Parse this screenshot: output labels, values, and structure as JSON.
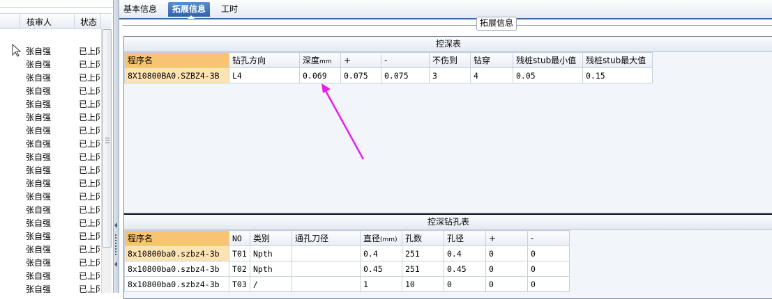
{
  "left_panel": {
    "columns": [
      "核审人",
      "状态"
    ],
    "rows": [
      {
        "reviewer": "张自强",
        "status": "已上冈"
      },
      {
        "reviewer": "张自强",
        "status": "已上冈"
      },
      {
        "reviewer": "张自强",
        "status": "已上冈"
      },
      {
        "reviewer": "张自强",
        "status": "已上冈"
      },
      {
        "reviewer": "张自强",
        "status": "已上冈"
      },
      {
        "reviewer": "张自强",
        "status": "已上冈"
      },
      {
        "reviewer": "张自强",
        "status": "已上冈"
      },
      {
        "reviewer": "张自强",
        "status": "已上冈"
      },
      {
        "reviewer": "张自强",
        "status": "已上冈"
      },
      {
        "reviewer": "张自强",
        "status": "已上冈"
      },
      {
        "reviewer": "张自强",
        "status": "已上冈"
      },
      {
        "reviewer": "张自强",
        "status": "已上冈"
      },
      {
        "reviewer": "张自强",
        "status": "已上冈"
      },
      {
        "reviewer": "张自强",
        "status": "已上冈"
      },
      {
        "reviewer": "张自强",
        "status": "已上冈"
      },
      {
        "reviewer": "张自强",
        "status": "已上冈"
      },
      {
        "reviewer": "张自强",
        "status": "已上冈"
      },
      {
        "reviewer": "张自强",
        "status": "已上冈"
      },
      {
        "reviewer": "张自强",
        "status": "已上冈"
      }
    ]
  },
  "tabs": [
    {
      "label": "基本信息",
      "active": false
    },
    {
      "label": "拓展信息",
      "active": true
    },
    {
      "label": "工时",
      "active": false
    }
  ],
  "fieldset_title": "拓展信息",
  "depth_table": {
    "title": "控深表",
    "headers": [
      "程序名",
      "钻孔方向",
      "深度",
      "+",
      "-",
      "不伤到",
      "钻穿",
      "残桩stub最小值",
      "残桩stub最大值"
    ],
    "depth_unit": "mm",
    "rows": [
      [
        "8X10800BA0.SZBZ4-3B",
        "L4",
        "0.069",
        "0.075",
        "0.075",
        "3",
        "4",
        "0.05",
        "0.15"
      ]
    ]
  },
  "drill_table": {
    "title": "控深钻孔表",
    "headers": [
      "程序名",
      "NO",
      "类别",
      "通孔刀径",
      "直径",
      "孔数",
      "孔径",
      "+",
      "-"
    ],
    "diameter_unit": "(mm)",
    "rows": [
      [
        "8x10800ba0.szbz4-3b",
        "T01",
        "Npth",
        "",
        "0.4",
        "251",
        "0.4",
        "0",
        "0"
      ],
      [
        "8x10800ba0.szbz4-3b",
        "T02",
        "Npth",
        "",
        "0.45",
        "251",
        "0.45",
        "0",
        "0"
      ],
      [
        "8x10800ba0.szbz4-3b",
        "T03",
        "/",
        "",
        "1",
        "10",
        "0",
        "0",
        "0"
      ]
    ]
  },
  "annotation": {
    "color": "#e81ee8",
    "icon": "arrow-icon"
  }
}
